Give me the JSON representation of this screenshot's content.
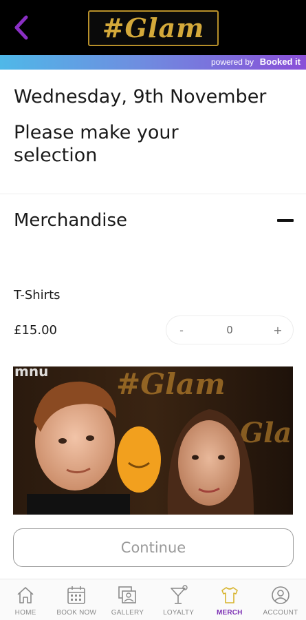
{
  "header": {
    "logo_text": "#Glam",
    "powered_by_label": "powered by",
    "powered_by_brand": "Booked it",
    "colors": {
      "background": "#000000",
      "accent": "#8a2fc4",
      "logo_gold": "#d4a93a"
    }
  },
  "page": {
    "date_title": "Wednesday, 9th November",
    "prompt": "Please make your selection"
  },
  "section": {
    "title": "Merchandise",
    "expanded": true
  },
  "product": {
    "name": "T-Shirts",
    "price": "£15.00",
    "quantity": "0",
    "minus_label": "-",
    "plus_label": "+"
  },
  "continue_label": "Continue",
  "nav": {
    "items": [
      {
        "label": "HOME",
        "icon": "home-icon",
        "active": false
      },
      {
        "label": "BOOK NOW",
        "icon": "calendar-icon",
        "active": false
      },
      {
        "label": "GALLERY",
        "icon": "gallery-icon",
        "active": false
      },
      {
        "label": "LOYALTY",
        "icon": "cocktail-icon",
        "active": false
      },
      {
        "label": "MERCH",
        "icon": "tshirt-icon",
        "active": true
      },
      {
        "label": "ACCOUNT",
        "icon": "account-icon",
        "active": false
      }
    ]
  }
}
